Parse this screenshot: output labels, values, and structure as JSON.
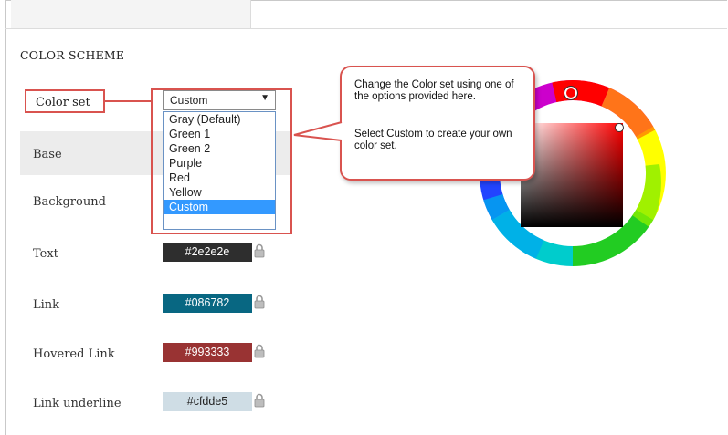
{
  "section": {
    "title": "COLOR SCHEME"
  },
  "color_set": {
    "label": "Color set",
    "selected": "Custom",
    "options": [
      "Gray (Default)",
      "Green 1",
      "Green 2",
      "Purple",
      "Red",
      "Yellow",
      "Custom"
    ]
  },
  "rows": [
    {
      "label": "Base"
    },
    {
      "label": "Background"
    },
    {
      "label": "Text",
      "value": "#2e2e2e",
      "bg": "#2e2e2e",
      "fg": "#ffffff"
    },
    {
      "label": "Link",
      "value": "#086782",
      "bg": "#086782",
      "fg": "#ffffff"
    },
    {
      "label": "Hovered Link",
      "value": "#993333",
      "bg": "#993333",
      "fg": "#ffffff"
    },
    {
      "label": "Link underline",
      "value": "#cfdde5",
      "bg": "#cfdde5",
      "fg": "#222222"
    }
  ],
  "callout": {
    "line1": "Change the Color set using one of the options provided here.",
    "line2": "Select Custom to create your own color set."
  },
  "colors": {
    "highlight": "#d9534f",
    "selection": "#3399ff"
  },
  "icons": [
    "lock-icon",
    "dropdown-arrow-icon",
    "color-wheel"
  ]
}
